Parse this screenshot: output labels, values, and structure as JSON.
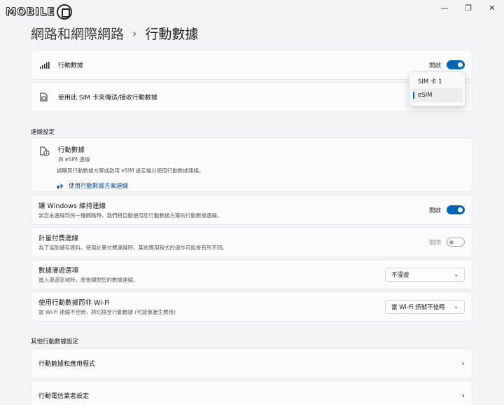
{
  "watermark": {
    "text": "MOBILE"
  },
  "window_controls": {
    "minimize": "—",
    "maximize": "❐",
    "close": "✕"
  },
  "breadcrumb": {
    "parent": "網路和網際網路",
    "separator": "›",
    "current": "行動數據"
  },
  "cellular": {
    "label": "行動數據",
    "toggle_label": "開啟",
    "toggle_state": "on"
  },
  "sim": {
    "label": "使用此 SIM 卡來傳送/接收行動數據"
  },
  "sim_popup": {
    "options": [
      "SIM 卡 1",
      "eSIM"
    ],
    "selected": "eSIM"
  },
  "connection_section": {
    "header": "連線設定"
  },
  "esim_card": {
    "title": "行動數據",
    "subtitle": "與 eSIM 連線",
    "description": "請購買行動數據方案或啟用 eSIM 設定檔以使用行動數據連線。",
    "link": "使用行動數據方案連線"
  },
  "windows_connect": {
    "title": "讓 Windows 維持連線",
    "subtitle": "當您未連線到另一種網路時，我們將自動使用您行動數據方案的行動數據連線。",
    "toggle_label": "開啟",
    "toggle_state": "on"
  },
  "metered": {
    "title": "計量付費連線",
    "subtitle": "為了協助儲存資料，使用計量付費連線時，某些應用程式的運作可能會有所不同。",
    "toggle_label": "關閉",
    "toggle_state": "off"
  },
  "roaming": {
    "title": "數據漫遊選項",
    "subtitle": "進入漫遊區域時，將會關閉您的數據連線。",
    "value": "不漫遊"
  },
  "use_cellular": {
    "title": "使用行動數據而非 Wi-Fi",
    "subtitle": "當 Wi-Fi 連線不佳時，將切換至行動數據 (可能會產生費用)",
    "value": "當 Wi-Fi 訊號不佳時"
  },
  "other_section": {
    "header": "其他行動數據設定"
  },
  "apps": {
    "label": "行動數據和應用程式"
  },
  "carrier": {
    "label": "行動電信業者設定"
  },
  "colors": {
    "accent": "#0067c0",
    "background": "#f3f4f8",
    "card": "#fbfbfc"
  }
}
